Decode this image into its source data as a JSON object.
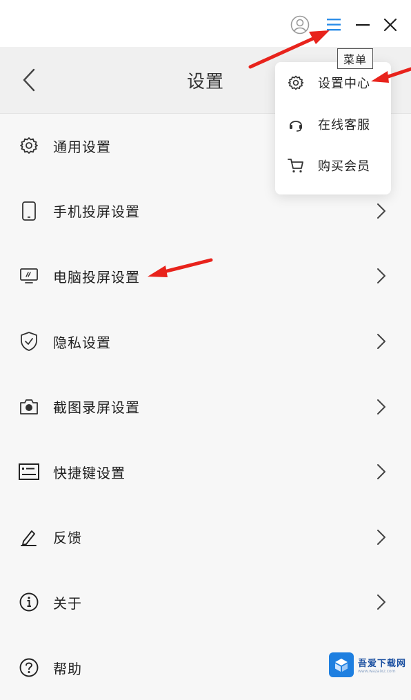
{
  "window": {
    "icons": {
      "user": "user-icon",
      "menu": "hamburger-menu-icon",
      "minimize": "minimize-icon",
      "close": "close-icon"
    },
    "menu_icon_color": "#2b8de8"
  },
  "header": {
    "title": "设置",
    "back_icon": "chevron-left-icon"
  },
  "settings_list": [
    {
      "label": "通用设置",
      "icon": "gear-icon",
      "has_chevron": false
    },
    {
      "label": "手机投屏设置",
      "icon": "phone-icon",
      "has_chevron": true
    },
    {
      "label": "电脑投屏设置",
      "icon": "monitor-icon",
      "has_chevron": true
    },
    {
      "label": "隐私设置",
      "icon": "shield-check-icon",
      "has_chevron": true
    },
    {
      "label": "截图录屏设置",
      "icon": "camera-icon",
      "has_chevron": true
    },
    {
      "label": "快捷键设置",
      "icon": "keyboard-shortcut-icon",
      "has_chevron": true
    },
    {
      "label": "反馈",
      "icon": "pen-icon",
      "has_chevron": true
    },
    {
      "label": "关于",
      "icon": "info-icon",
      "has_chevron": true
    },
    {
      "label": "帮助",
      "icon": "help-icon",
      "has_chevron": false
    }
  ],
  "tooltip": {
    "text": "菜单"
  },
  "dropdown_menu": {
    "items": [
      {
        "label": "设置中心",
        "icon": "gear-icon"
      },
      {
        "label": "在线客服",
        "icon": "headset-icon"
      },
      {
        "label": "购买会员",
        "icon": "cart-icon"
      }
    ]
  },
  "annotation_color": "#e8231c",
  "watermark": {
    "text": "吾爱下载网",
    "subtext": "www.wazaixz.com"
  }
}
